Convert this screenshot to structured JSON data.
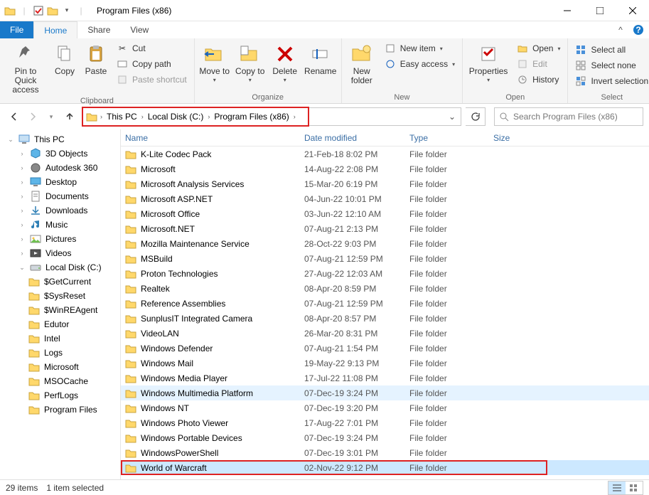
{
  "window": {
    "title": "Program Files (x86)"
  },
  "tabs": {
    "file": "File",
    "home": "Home",
    "share": "Share",
    "view": "View"
  },
  "ribbon": {
    "clipboard": {
      "label": "Clipboard",
      "pin": "Pin to Quick access",
      "copy": "Copy",
      "paste": "Paste",
      "cut": "Cut",
      "copypath": "Copy path",
      "pasteshortcut": "Paste shortcut"
    },
    "organize": {
      "label": "Organize",
      "moveto": "Move to",
      "copyto": "Copy to",
      "delete": "Delete",
      "rename": "Rename"
    },
    "new": {
      "label": "New",
      "newfolder": "New folder",
      "newitem": "New item",
      "easyaccess": "Easy access"
    },
    "open": {
      "label": "Open",
      "properties": "Properties",
      "open": "Open",
      "edit": "Edit",
      "history": "History"
    },
    "select": {
      "label": "Select",
      "selectall": "Select all",
      "selectnone": "Select none",
      "invert": "Invert selection"
    }
  },
  "breadcrumb": {
    "pc": "This PC",
    "drive": "Local Disk (C:)",
    "folder": "Program Files (x86)"
  },
  "search": {
    "placeholder": "Search Program Files (x86)"
  },
  "navpane": {
    "thispc": "This PC",
    "items": [
      {
        "label": "3D Objects",
        "icon": "3d"
      },
      {
        "label": "Autodesk 360",
        "icon": "autodesk"
      },
      {
        "label": "Desktop",
        "icon": "desktop"
      },
      {
        "label": "Documents",
        "icon": "docs"
      },
      {
        "label": "Downloads",
        "icon": "downloads"
      },
      {
        "label": "Music",
        "icon": "music"
      },
      {
        "label": "Pictures",
        "icon": "pictures"
      },
      {
        "label": "Videos",
        "icon": "videos"
      },
      {
        "label": "Local Disk (C:)",
        "icon": "drive",
        "expanded": true
      }
    ],
    "subitems": [
      "$GetCurrent",
      "$SysReset",
      "$WinREAgent",
      "Edutor",
      "Intel",
      "Logs",
      "Microsoft",
      "MSOCache",
      "PerfLogs",
      "Program Files"
    ]
  },
  "columns": {
    "name": "Name",
    "date": "Date modified",
    "type": "Type",
    "size": "Size"
  },
  "files": [
    {
      "name": "K-Lite Codec Pack",
      "date": "21-Feb-18 8:02 PM",
      "type": "File folder"
    },
    {
      "name": "Microsoft",
      "date": "14-Aug-22 2:08 PM",
      "type": "File folder"
    },
    {
      "name": "Microsoft Analysis Services",
      "date": "15-Mar-20 6:19 PM",
      "type": "File folder"
    },
    {
      "name": "Microsoft ASP.NET",
      "date": "04-Jun-22 10:01 PM",
      "type": "File folder"
    },
    {
      "name": "Microsoft Office",
      "date": "03-Jun-22 12:10 AM",
      "type": "File folder"
    },
    {
      "name": "Microsoft.NET",
      "date": "07-Aug-21 2:13 PM",
      "type": "File folder"
    },
    {
      "name": "Mozilla Maintenance Service",
      "date": "28-Oct-22 9:03 PM",
      "type": "File folder"
    },
    {
      "name": "MSBuild",
      "date": "07-Aug-21 12:59 PM",
      "type": "File folder"
    },
    {
      "name": "Proton Technologies",
      "date": "27-Aug-22 12:03 AM",
      "type": "File folder"
    },
    {
      "name": "Realtek",
      "date": "08-Apr-20 8:59 PM",
      "type": "File folder"
    },
    {
      "name": "Reference Assemblies",
      "date": "07-Aug-21 12:59 PM",
      "type": "File folder"
    },
    {
      "name": "SunplusIT Integrated Camera",
      "date": "08-Apr-20 8:57 PM",
      "type": "File folder"
    },
    {
      "name": "VideoLAN",
      "date": "26-Mar-20 8:31 PM",
      "type": "File folder"
    },
    {
      "name": "Windows Defender",
      "date": "07-Aug-21 1:54 PM",
      "type": "File folder"
    },
    {
      "name": "Windows Mail",
      "date": "19-May-22 9:13 PM",
      "type": "File folder"
    },
    {
      "name": "Windows Media Player",
      "date": "17-Jul-22 11:08 PM",
      "type": "File folder"
    },
    {
      "name": "Windows Multimedia Platform",
      "date": "07-Dec-19 3:24 PM",
      "type": "File folder",
      "hover": true
    },
    {
      "name": "Windows NT",
      "date": "07-Dec-19 3:20 PM",
      "type": "File folder"
    },
    {
      "name": "Windows Photo Viewer",
      "date": "17-Aug-22 7:01 PM",
      "type": "File folder"
    },
    {
      "name": "Windows Portable Devices",
      "date": "07-Dec-19 3:24 PM",
      "type": "File folder"
    },
    {
      "name": "WindowsPowerShell",
      "date": "07-Dec-19 3:01 PM",
      "type": "File folder"
    },
    {
      "name": "World of Warcraft",
      "date": "02-Nov-22 9:12 PM",
      "type": "File folder",
      "selected": true,
      "highlight": true
    }
  ],
  "status": {
    "count": "29 items",
    "sel": "1 item selected"
  }
}
